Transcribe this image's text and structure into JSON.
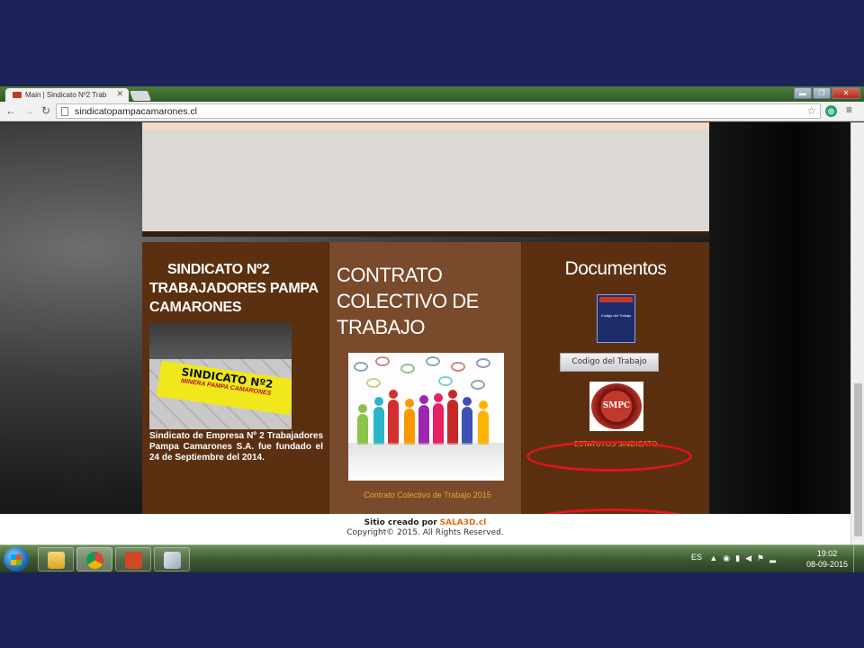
{
  "browser": {
    "tab_title": "Main | Sindicato Nº2 Trab",
    "tab_close": "✕",
    "url": "sindicatopampacamarones.cl",
    "back": "←",
    "forward": "→",
    "reload": "↻",
    "star": "☆",
    "menu": "≡",
    "window_buttons": [
      "▬",
      "❐",
      "✕"
    ]
  },
  "site": {
    "sindicato": {
      "title_lines": [
        "SINDICATO Nº2",
        "TRABAJADORES PAMPA",
        "CAMARONES"
      ],
      "banner_line1": "SINDICATO Nº2",
      "banner_line2": "MINERA PAMPA CAMARONES",
      "description": "Sindicato de Empresa Nº 2 Trabajadores Pampa Camarones S.A. fue fundado el 24 de Septiembre del 2014."
    },
    "contrato": {
      "title_lines": [
        "CONTRATO",
        "COLECTIVO DE",
        "TRABAJO"
      ],
      "link": "Contrato Colectivo de Trabajo 2015"
    },
    "documentos": {
      "title": "Documentos",
      "book_text": "Codigo del Trabajo",
      "button": "Codigo del Trabajo",
      "logo_text": "SMPC",
      "link": "ESTATUTOS SINDICATO"
    },
    "footer": {
      "created_by": "Sitio creado por",
      "brand": "SALA3D.cl",
      "copyright": "Copyright© 2015. All Rights Reserved."
    }
  },
  "taskbar": {
    "language": "ES",
    "time": "19:02",
    "date": "08-09-2015"
  },
  "colors": {
    "highlight_ring": "#e2141b",
    "link_orange": "#f0a02c",
    "panel_brown": "#5b3011"
  }
}
